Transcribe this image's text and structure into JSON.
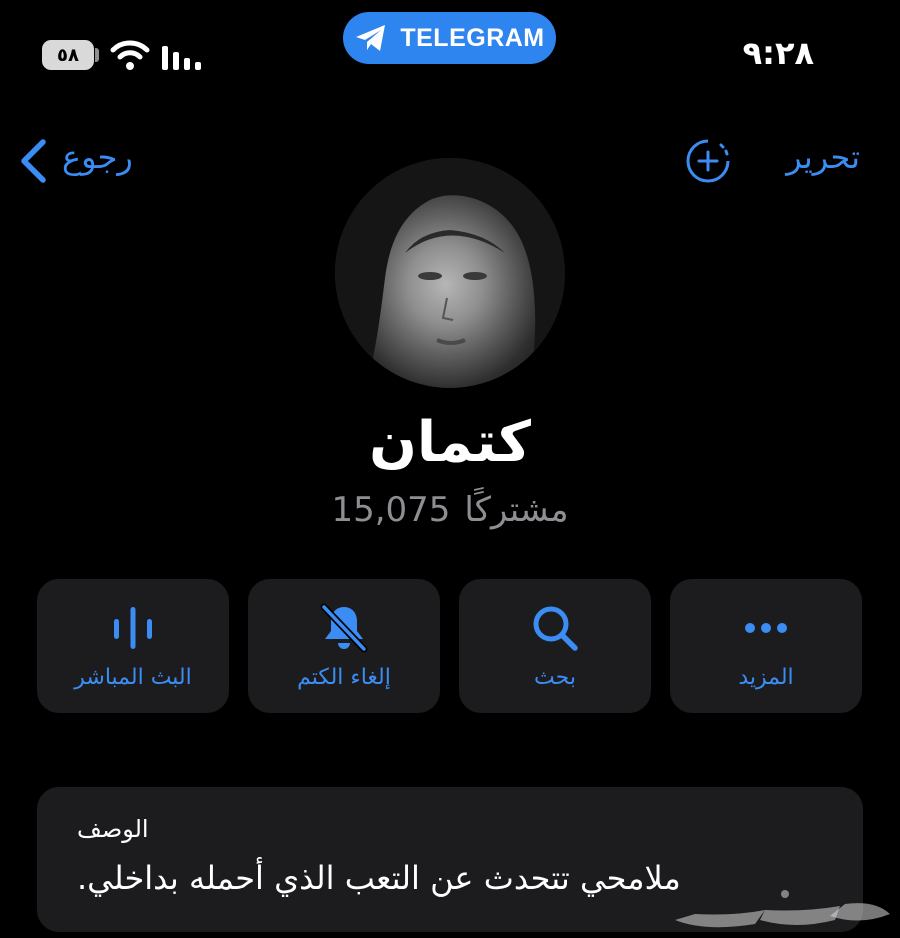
{
  "status_bar": {
    "time": "٩:٢٨",
    "battery": "٥٨",
    "pill_label": "TELEGRAM"
  },
  "nav": {
    "back_label": "رجوع",
    "edit_label": "تحرير"
  },
  "profile": {
    "name": "كتمان",
    "subscriber_count": "15,075",
    "subscriber_word": "مشتركًا"
  },
  "actions": [
    {
      "label": "البث المباشر",
      "icon": "live-stream-icon"
    },
    {
      "label": "إلغاء الكتم",
      "icon": "bell-slash-icon"
    },
    {
      "label": "بحث",
      "icon": "search-icon"
    },
    {
      "label": "المزيد",
      "icon": "more-icon"
    }
  ],
  "description": {
    "title": "الوصف",
    "text": "ملامحي تتحدث عن التعب الذي أحمله بداخلي."
  },
  "colors": {
    "accent": "#3b8cf3",
    "background": "#000000",
    "card": "#1c1c1e",
    "secondary_text": "#8e8e93",
    "pill": "#2f85f0"
  }
}
